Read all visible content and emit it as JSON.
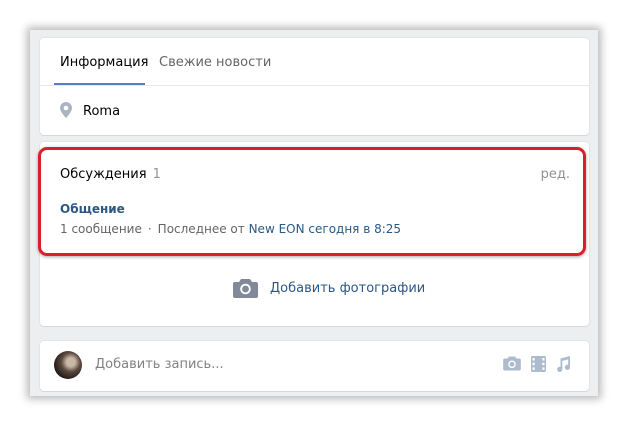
{
  "tabs": [
    {
      "label": "Информация",
      "active": true
    },
    {
      "label": "Свежие новости",
      "active": false
    }
  ],
  "location": {
    "text": "Roma",
    "icon": "map-pin-icon"
  },
  "discussions": {
    "title": "Обсуждения",
    "count": "1",
    "edit_label": "ред.",
    "topic": {
      "title": "Общение",
      "messages": "1 сообщение",
      "separator": "·",
      "last_prefix": "Последнее от",
      "author": "New EON",
      "time": "сегодня в 8:25"
    }
  },
  "add_photo": {
    "label": "Добавить фотографии",
    "icon": "camera-icon"
  },
  "composer": {
    "placeholder": "Добавить запись...",
    "icons": [
      "camera-icon",
      "video-icon",
      "music-icon"
    ]
  },
  "colors": {
    "accent": "#5181b8",
    "link": "#2a5885",
    "highlight": "#d8202b",
    "muted": "#939393",
    "icon": "#adbbcd"
  }
}
